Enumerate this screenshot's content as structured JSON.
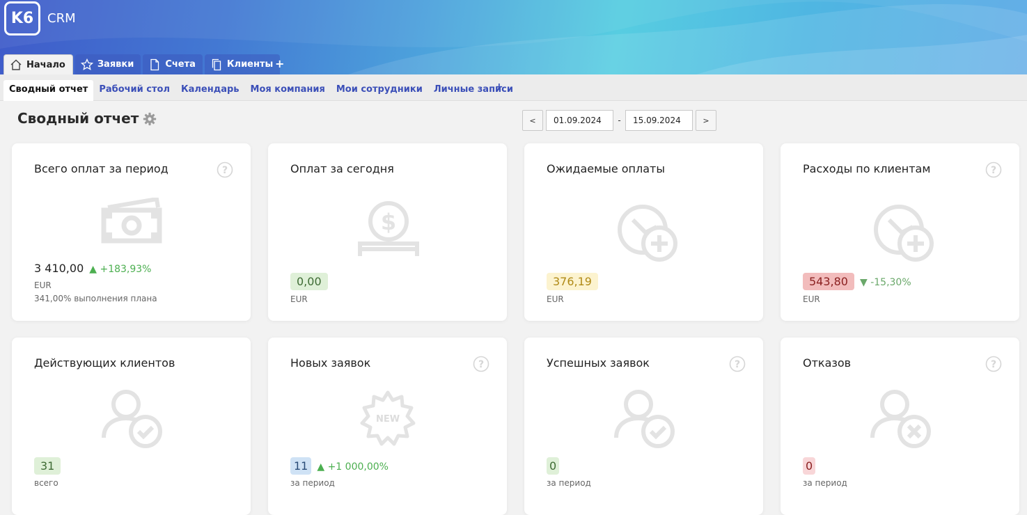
{
  "app": {
    "logo": "K6",
    "name": "CRM"
  },
  "main_tabs": [
    {
      "label": "Начало",
      "icon": "home-icon",
      "active": true
    },
    {
      "label": "Заявки",
      "icon": "star-icon",
      "active": false
    },
    {
      "label": "Счета",
      "icon": "document-icon",
      "active": false
    },
    {
      "label": "Клиенты",
      "icon": "copy-icon",
      "active": false
    }
  ],
  "main_tabs_add": "+",
  "sub_tabs": [
    {
      "label": "Сводный отчет",
      "active": true
    },
    {
      "label": "Рабочий стол",
      "active": false
    },
    {
      "label": "Календарь",
      "active": false
    },
    {
      "label": "Моя компания",
      "active": false
    },
    {
      "label": "Мои сотрудники",
      "active": false
    },
    {
      "label": "Личные записи",
      "active": false
    }
  ],
  "sub_tabs_add": "+",
  "page": {
    "title": "Сводный отчет"
  },
  "date_range": {
    "prev": "<",
    "from": "01.09.2024",
    "sep": "-",
    "to": "15.09.2024",
    "next": ">"
  },
  "cards": {
    "total_payments": {
      "title": "Всего оплат за период",
      "value": "3 410,00",
      "delta": "▲ +183,93%",
      "currency": "EUR",
      "plan": "341,00% выполнения плана",
      "icon": "banknote-icon"
    },
    "today_payments": {
      "title": "Оплат за сегодня",
      "value": "0,00",
      "currency": "EUR",
      "icon": "coin-hand-icon"
    },
    "expected_payments": {
      "title": "Ожидаемые оплаты",
      "value": "376,19",
      "currency": "EUR",
      "icon": "clock-plus-icon"
    },
    "client_expenses": {
      "title": "Расходы по клиентам",
      "value": "543,80",
      "delta": "▼ -15,30%",
      "currency": "EUR",
      "icon": "clock-plus-icon"
    },
    "active_clients": {
      "title": "Действующих клиентов",
      "value": "31",
      "note": "всего",
      "icon": "user-check-icon"
    },
    "new_requests": {
      "title": "Новых заявок",
      "value": "11",
      "delta": "▲ +1 000,00%",
      "note": "за период",
      "icon": "new-badge-icon",
      "badge_text": "NEW"
    },
    "successful_requests": {
      "title": "Успешных заявок",
      "value": "0",
      "note": "за период",
      "icon": "user-check-icon"
    },
    "rejections": {
      "title": "Отказов",
      "value": "0",
      "note": "за период",
      "icon": "user-cross-icon"
    }
  },
  "colors": {
    "accent_link": "#3b4fb8",
    "positive": "#4caf50",
    "icon_grey": "#e3e3e3"
  }
}
